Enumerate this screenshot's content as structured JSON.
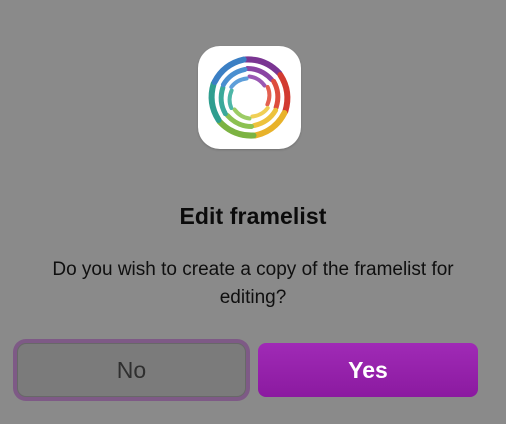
{
  "dialog": {
    "title": "Edit framelist",
    "message": "Do you wish to create a copy of the framelist for editing?",
    "icon": "app-swirl-icon",
    "buttons": {
      "no_label": "No",
      "yes_label": "Yes"
    },
    "colors": {
      "background": "#8a8a8a",
      "primary": "#9323a8",
      "focus_ring": "#7e5a86"
    }
  }
}
